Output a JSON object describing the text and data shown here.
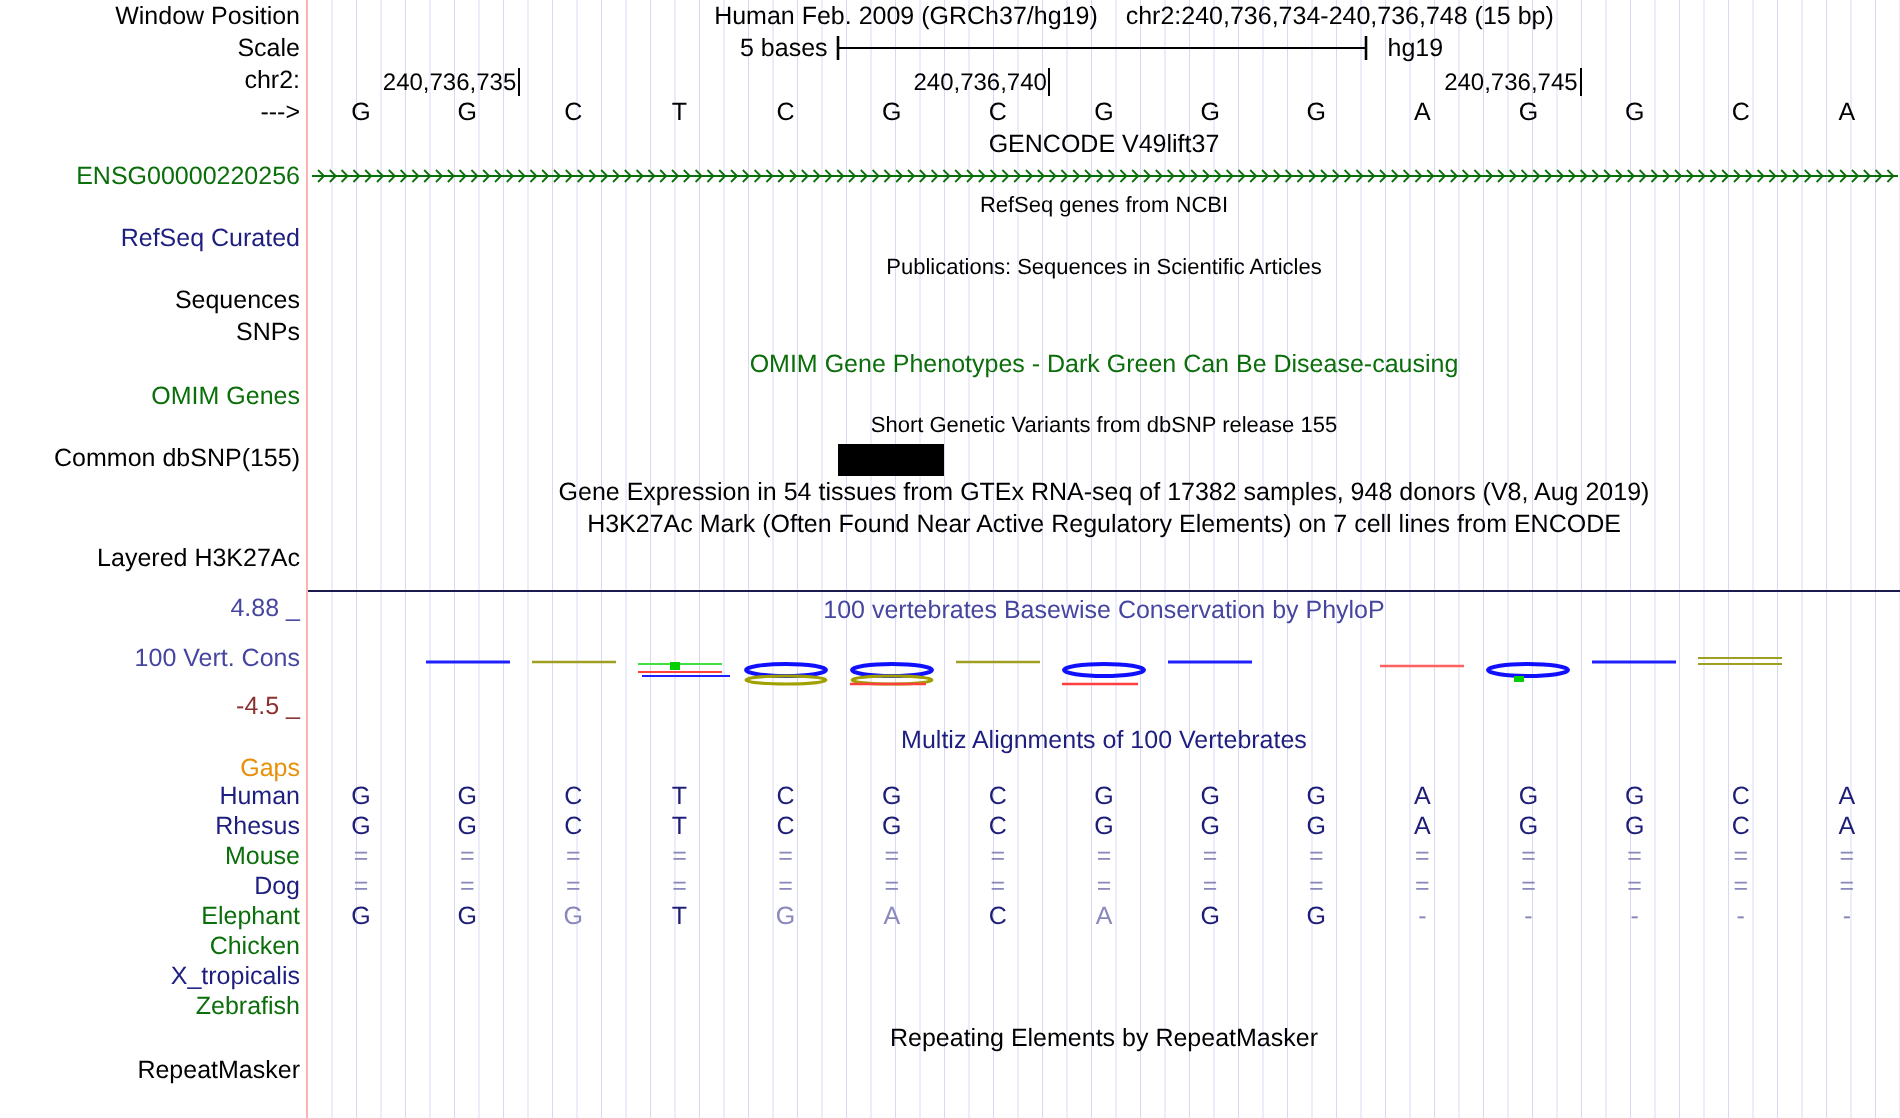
{
  "header": {
    "position_label": "Window Position",
    "assembly": "Human Feb. 2009 (GRCh37/hg19)",
    "position": "chr2:240,736,734-240,736,748 (15 bp)",
    "scale_label": "Scale",
    "scale_text": "5 bases",
    "scale_db": "hg19",
    "chrom_label": "chr2:",
    "ticks": [
      "240,736,735",
      "240,736,740",
      "240,736,745"
    ],
    "strand_label": "--->",
    "bases": [
      "G",
      "G",
      "C",
      "T",
      "C",
      "G",
      "C",
      "G",
      "G",
      "G",
      "A",
      "G",
      "G",
      "C",
      "A"
    ]
  },
  "tracks": [
    {
      "kind": "title",
      "text": "GENCODE V49lift37",
      "color": "#000000"
    },
    {
      "kind": "gene",
      "label": "ENSG00000220256",
      "color": "#0a6e0a"
    },
    {
      "kind": "small_title",
      "text": "RefSeq genes from NCBI",
      "color": "#000000"
    },
    {
      "kind": "label",
      "label": "RefSeq Curated",
      "color": "#1e1e80"
    },
    {
      "kind": "small_title",
      "text": "Publications: Sequences in Scientific Articles",
      "color": "#000000"
    },
    {
      "kind": "label",
      "label": "Sequences",
      "color": "#000000"
    },
    {
      "kind": "label",
      "label": "SNPs",
      "color": "#000000"
    },
    {
      "kind": "title",
      "text": "OMIM Gene Phenotypes - Dark Green Can Be Disease-causing",
      "color": "#0a6e0a"
    },
    {
      "kind": "label",
      "label": "OMIM Genes",
      "color": "#0a6e0a"
    },
    {
      "kind": "small_title",
      "text": "Short Genetic Variants from dbSNP release 155",
      "color": "#000000"
    },
    {
      "kind": "snp",
      "label": "Common dbSNP(155)",
      "color": "#000000",
      "variants": [
        false,
        false,
        false,
        false,
        false,
        true,
        false,
        false,
        false,
        false,
        false,
        false,
        false,
        false,
        false
      ]
    },
    {
      "kind": "title",
      "text": "Gene Expression in 54 tissues from GTEx RNA-seq of 17382 samples, 948 donors (V8, Aug 2019)",
      "color": "#000000"
    },
    {
      "kind": "title",
      "text": "H3K27Ac Mark (Often Found Near Active Regulatory Elements) on 7 cell lines from ENCODE",
      "color": "#000000"
    },
    {
      "kind": "layered",
      "label": "Layered H3K27Ac",
      "color": "#000000"
    },
    {
      "kind": "cons_title",
      "label": "4.88 _",
      "text": "100 vertebrates Basewise Conservation by PhyloP",
      "color": "#4646a0"
    },
    {
      "kind": "cons_plot",
      "label": "100 Vert. Cons",
      "color": "#4646a0"
    },
    {
      "kind": "cons_min",
      "label": "-4.5 _",
      "color": "#8b3030"
    },
    {
      "kind": "title",
      "text": "Multiz Alignments of 100 Vertebrates",
      "color": "#1e1e80"
    },
    {
      "kind": "gaps",
      "label": "Gaps",
      "color": "#e8900a"
    },
    {
      "kind": "species",
      "label": "Human",
      "color": "#1e1e80",
      "bases": [
        {
          "b": "G",
          "faded": false
        },
        {
          "b": "G",
          "faded": false
        },
        {
          "b": "C",
          "faded": false
        },
        {
          "b": "T",
          "faded": false
        },
        {
          "b": "C",
          "faded": false
        },
        {
          "b": "G",
          "faded": false
        },
        {
          "b": "C",
          "faded": false
        },
        {
          "b": "G",
          "faded": false
        },
        {
          "b": "G",
          "faded": false
        },
        {
          "b": "G",
          "faded": false
        },
        {
          "b": "A",
          "faded": false
        },
        {
          "b": "G",
          "faded": false
        },
        {
          "b": "G",
          "faded": false
        },
        {
          "b": "C",
          "faded": false
        },
        {
          "b": "A",
          "faded": false
        }
      ]
    },
    {
      "kind": "species",
      "label": "Rhesus",
      "color": "#1e1e80",
      "bases": [
        {
          "b": "G",
          "faded": false
        },
        {
          "b": "G",
          "faded": false
        },
        {
          "b": "C",
          "faded": false
        },
        {
          "b": "T",
          "faded": false
        },
        {
          "b": "C",
          "faded": false
        },
        {
          "b": "G",
          "faded": false
        },
        {
          "b": "C",
          "faded": false
        },
        {
          "b": "G",
          "faded": false
        },
        {
          "b": "G",
          "faded": false
        },
        {
          "b": "G",
          "faded": false
        },
        {
          "b": "A",
          "faded": false
        },
        {
          "b": "G",
          "faded": false
        },
        {
          "b": "G",
          "faded": false
        },
        {
          "b": "C",
          "faded": false
        },
        {
          "b": "A",
          "faded": false
        }
      ]
    },
    {
      "kind": "species",
      "label": "Mouse",
      "color": "#0a6e0a",
      "bases": [
        {
          "b": "=",
          "faded": true
        },
        {
          "b": "=",
          "faded": true
        },
        {
          "b": "=",
          "faded": true
        },
        {
          "b": "=",
          "faded": true
        },
        {
          "b": "=",
          "faded": true
        },
        {
          "b": "=",
          "faded": true
        },
        {
          "b": "=",
          "faded": true
        },
        {
          "b": "=",
          "faded": true
        },
        {
          "b": "=",
          "faded": true
        },
        {
          "b": "=",
          "faded": true
        },
        {
          "b": "=",
          "faded": true
        },
        {
          "b": "=",
          "faded": true
        },
        {
          "b": "=",
          "faded": true
        },
        {
          "b": "=",
          "faded": true
        },
        {
          "b": "=",
          "faded": true
        }
      ]
    },
    {
      "kind": "species",
      "label": "Dog",
      "color": "#1e1e80",
      "bases": [
        {
          "b": "=",
          "faded": true
        },
        {
          "b": "=",
          "faded": true
        },
        {
          "b": "=",
          "faded": true
        },
        {
          "b": "=",
          "faded": true
        },
        {
          "b": "=",
          "faded": true
        },
        {
          "b": "=",
          "faded": true
        },
        {
          "b": "=",
          "faded": true
        },
        {
          "b": "=",
          "faded": true
        },
        {
          "b": "=",
          "faded": true
        },
        {
          "b": "=",
          "faded": true
        },
        {
          "b": "=",
          "faded": true
        },
        {
          "b": "=",
          "faded": true
        },
        {
          "b": "=",
          "faded": true
        },
        {
          "b": "=",
          "faded": true
        },
        {
          "b": "=",
          "faded": true
        }
      ]
    },
    {
      "kind": "species",
      "label": "Elephant",
      "color": "#0a6e0a",
      "bases": [
        {
          "b": "G",
          "faded": false
        },
        {
          "b": "G",
          "faded": false
        },
        {
          "b": "G",
          "faded": true
        },
        {
          "b": "T",
          "faded": false
        },
        {
          "b": "G",
          "faded": true
        },
        {
          "b": "A",
          "faded": true
        },
        {
          "b": "C",
          "faded": false
        },
        {
          "b": "A",
          "faded": true
        },
        {
          "b": "G",
          "faded": false
        },
        {
          "b": "G",
          "faded": false
        },
        {
          "b": "-",
          "faded": true
        },
        {
          "b": "-",
          "faded": true
        },
        {
          "b": "-",
          "faded": true
        },
        {
          "b": "-",
          "faded": true
        },
        {
          "b": "-",
          "faded": true
        }
      ]
    },
    {
      "kind": "species",
      "label": "Chicken",
      "color": "#0a6e0a"
    },
    {
      "kind": "species",
      "label": "X_tropicalis",
      "color": "#1e1e80"
    },
    {
      "kind": "species",
      "label": "Zebrafish",
      "color": "#0a6e0a"
    },
    {
      "kind": "title",
      "text": "Repeating Elements by RepeatMasker",
      "color": "#000000"
    },
    {
      "kind": "label",
      "label": "RepeatMasker",
      "color": "#000000"
    }
  ]
}
